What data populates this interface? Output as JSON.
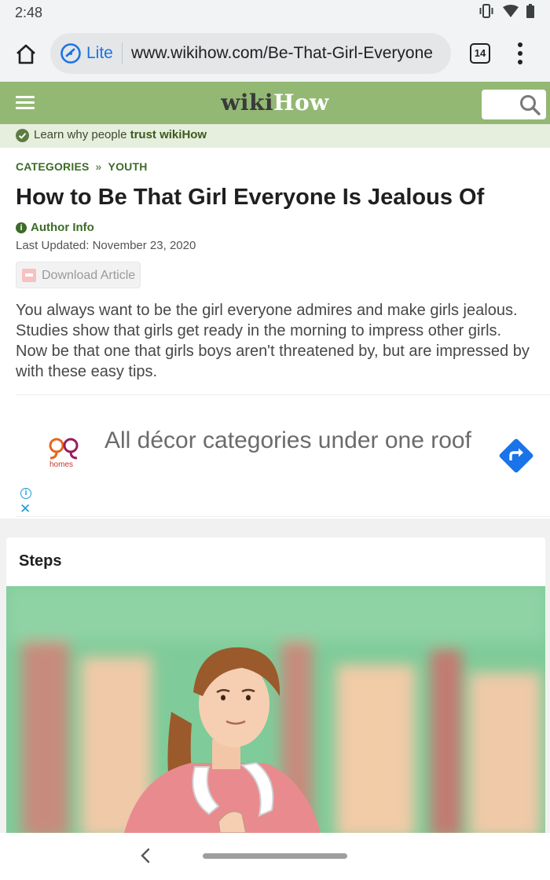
{
  "status_bar": {
    "time": "2:48",
    "icons": [
      "vibrate-icon",
      "wifi-icon",
      "battery-icon"
    ]
  },
  "browser": {
    "lite_label": "Lite",
    "url": "www.wikihow.com/Be-That-Girl-Everyone",
    "tab_count": "14",
    "accent_color": "#1a73e8"
  },
  "wikihow": {
    "logo_wiki": "wiki",
    "logo_how": "How",
    "header_color": "#93b874",
    "trust_prefix": "Learn why people ",
    "trust_link": "trust wikiHow"
  },
  "article": {
    "breadcrumb": [
      "CATEGORIES",
      "YOUTH"
    ],
    "breadcrumb_sep": "»",
    "title": "How to Be That Girl Everyone Is Jealous Of",
    "author_label": "Author Info",
    "last_updated": "Last Updated: November 23, 2020",
    "download_label": "Download Article",
    "intro": "You always want to be the girl everyone admires and make girls jealous. Studies show that girls get ready in the morning to impress other girls. Now be that one that girls boys aren't threatened by, but are impressed by with these easy tips."
  },
  "ad": {
    "brand": "homes",
    "text": "All décor categories under one roof"
  },
  "steps": {
    "label": "Steps"
  }
}
